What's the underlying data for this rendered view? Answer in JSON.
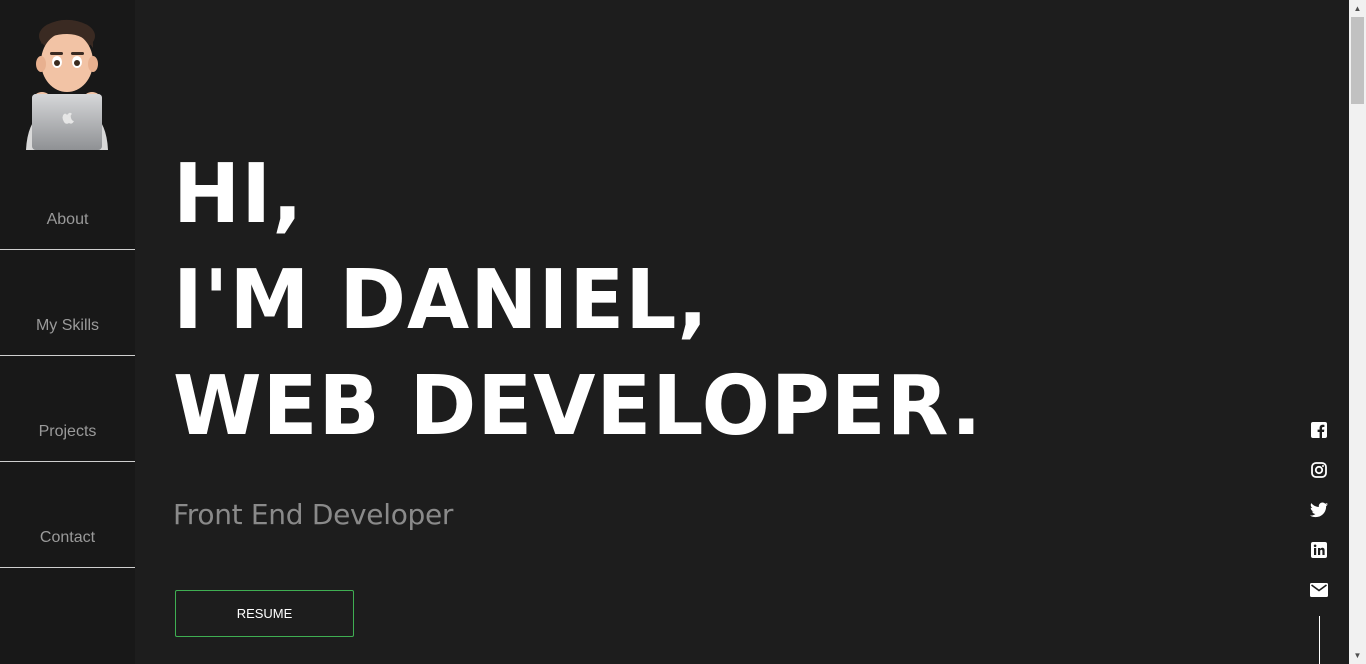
{
  "sidebar": {
    "avatar_icon": "memoji-laptop-avatar",
    "items": [
      {
        "label": "About"
      },
      {
        "label": "My Skills"
      },
      {
        "label": "Projects"
      },
      {
        "label": "Contact"
      }
    ]
  },
  "hero": {
    "line1": "HI,",
    "line2": "I'M DANIEL,",
    "line3": "WEB DEVELOPER.",
    "subtitle": "Front End Developer",
    "resume_label": "RESUME"
  },
  "socials": [
    {
      "icon": "facebook-icon"
    },
    {
      "icon": "instagram-icon"
    },
    {
      "icon": "twitter-icon"
    },
    {
      "icon": "linkedin-icon"
    },
    {
      "icon": "mail-icon"
    }
  ],
  "colors": {
    "background": "#1d1d1d",
    "sidebar": "#181818",
    "accent": "#3fae52",
    "text": "#ffffff",
    "muted": "#8a8a8a"
  }
}
